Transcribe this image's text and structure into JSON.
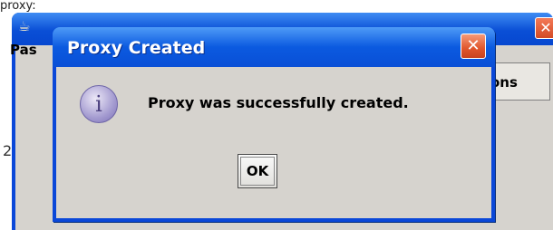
{
  "background": {
    "corner_text": "proxy:",
    "pass_label": "Pas",
    "options_button": "ons",
    "left_number": "2",
    "app_icon": "java-cup-icon",
    "close_glyph": "✕"
  },
  "dialog": {
    "title": "Proxy Created",
    "close_glyph": "✕",
    "icon": "information-icon",
    "icon_glyph": "i",
    "message": "Proxy was successfully created.",
    "ok_label": "OK"
  },
  "colors": {
    "titlebar_blue": "#0a4fd6",
    "close_red": "#e0562c",
    "dialog_body": "#d6d3ce"
  }
}
